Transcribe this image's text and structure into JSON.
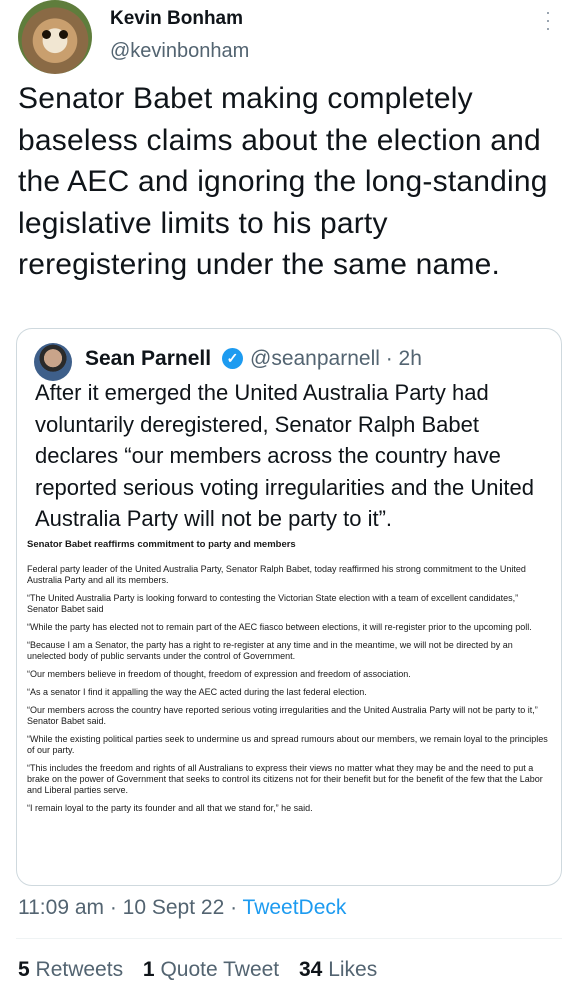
{
  "author": {
    "display_name": "Kevin Bonham",
    "handle": "@kevinbonham"
  },
  "tweet": {
    "text": "Senator Babet making completely baseless claims about the election and the AEC and ignoring the long-standing legislative limits to his party reregistering under the same name."
  },
  "quoted": {
    "display_name": "Sean Parnell",
    "verified_mark": "✓",
    "handle_time": "@seanparnell · 2h",
    "text": "After it emerged the United Australia Party had voluntarily deregistered, Senator Ralph Babet declares “our members across the country have reported serious voting irregularities and the United Australia Party will not be party to it”.",
    "document": {
      "title": "Senator Babet reaffirms commitment to party and members",
      "paragraphs": [
        "Federal party leader of the United Australia Party, Senator Ralph Babet, today reaffirmed his strong commitment to the United Australia Party and all its members.",
        "“The United Australia Party is looking forward to contesting the Victorian State election with a team of excellent candidates,” Senator Babet said",
        "“While the party has elected not to remain part of the AEC fiasco between elections, it will re-register prior to the upcoming poll.",
        "“Because I am a Senator, the party has a right to re-register at any time and in the meantime, we will not be directed by an unelected body of public servants under the control of Government.",
        "“Our members believe in freedom of thought, freedom of expression and freedom of association.",
        "“As a senator I find it appalling the way the AEC acted during the last federal election.",
        "“Our members across the country have reported serious voting irregularities and the United Australia Party will not be party to it,” Senator Babet said.",
        "“While the existing political parties seek to undermine us and spread rumours about our members, we remain loyal to the principles of our party.",
        "“This includes the freedom and rights of all Australians to express their views no matter what they may be and the need to put a brake on the power of Government that seeks to control its citizens not for their benefit but for the benefit of the few that the Labor and Liberal parties serve.",
        "“I remain loyal to the party its founder and all that we stand for,” he said."
      ]
    }
  },
  "meta": {
    "timestamp": "11:09 am · 10 Sept 22 · ",
    "source": "TweetDeck"
  },
  "stats": {
    "retweets_count": "5",
    "retweets_label": "Retweets",
    "quotes_count": "1",
    "quotes_label": "Quote Tweet",
    "likes_count": "34",
    "likes_label": "Likes"
  },
  "icons": {
    "more": "more-options-icon",
    "verified": "verified-badge-icon"
  },
  "colors": {
    "accent": "#1d9bf0",
    "secondary_text": "#536471",
    "border": "#cfd9de"
  }
}
